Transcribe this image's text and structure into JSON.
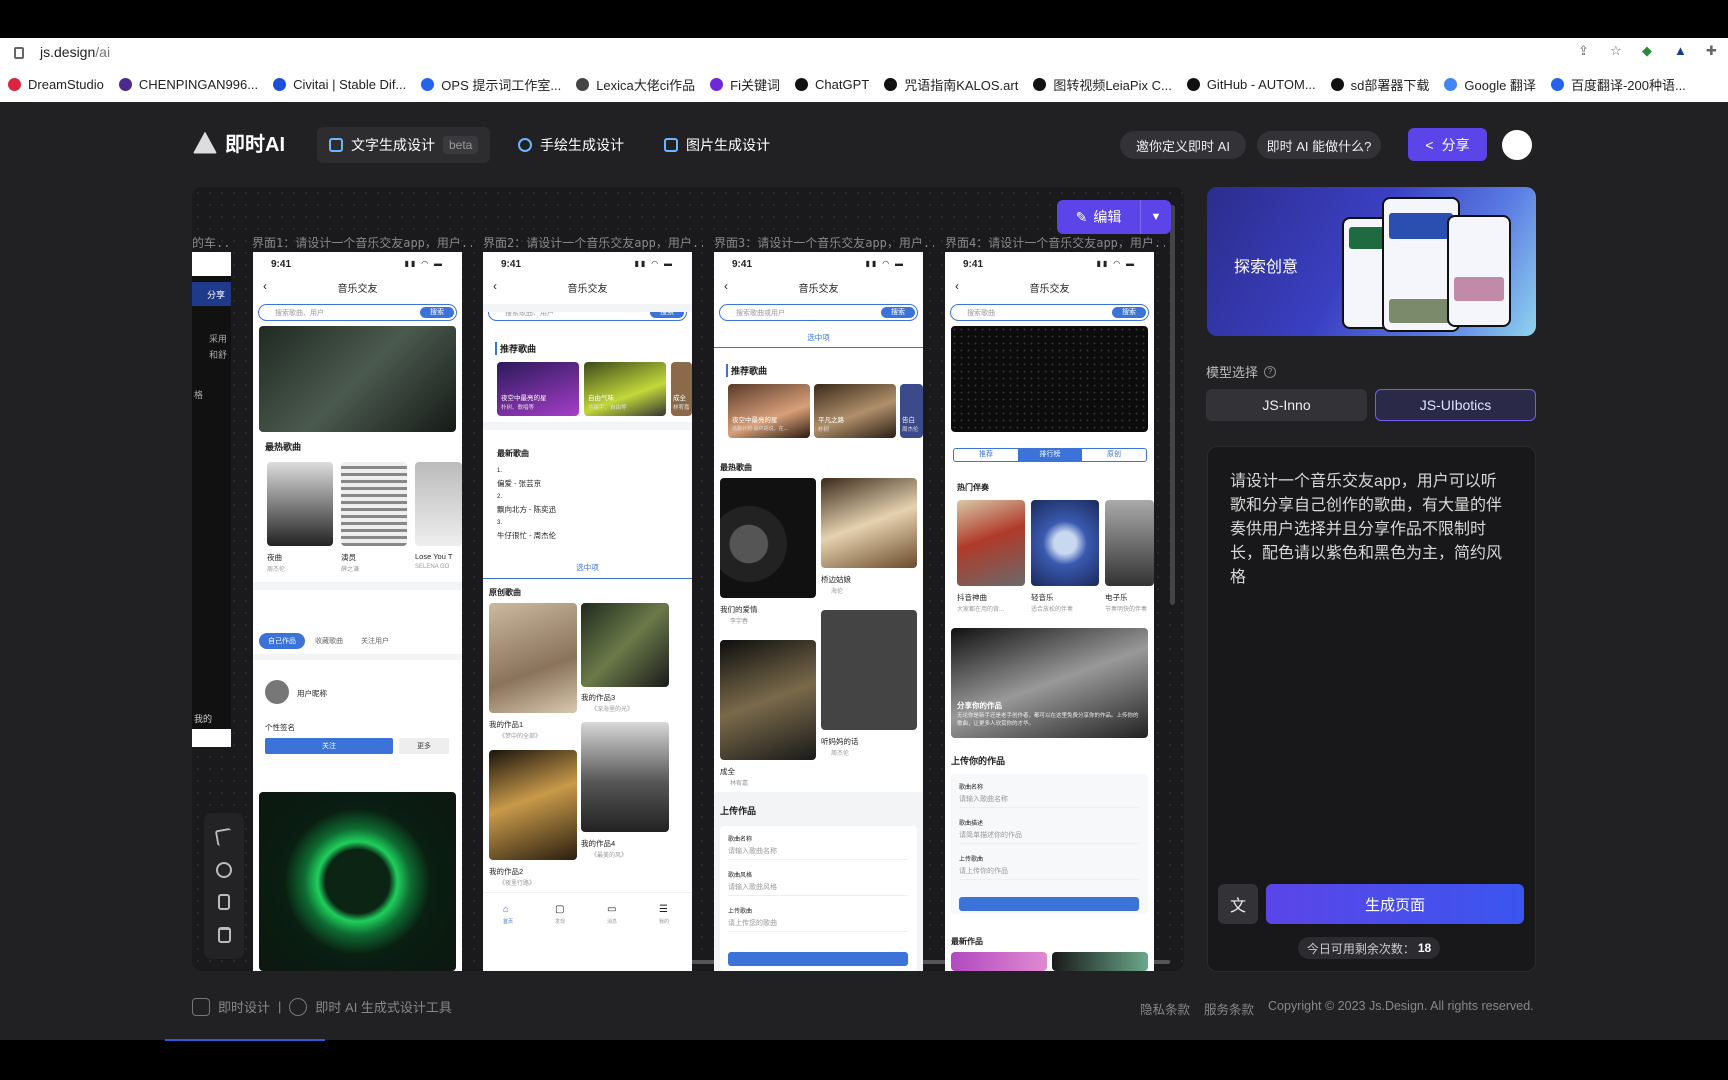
{
  "browser": {
    "url_host": "js.design",
    "url_path": "/ai",
    "bookmarks": [
      {
        "label": "DreamStudio",
        "color": "#d7263d"
      },
      {
        "label": "CHENPINGAN996...",
        "color": "#4a2a8a"
      },
      {
        "label": "Civitai | Stable Dif...",
        "color": "#1d4ed8"
      },
      {
        "label": "OPS 提示词工作室...",
        "color": "#2563eb"
      },
      {
        "label": "Lexica大佬ci作品",
        "color": "#444444"
      },
      {
        "label": "Fi关键词",
        "color": "#6d28d9"
      },
      {
        "label": "ChatGPT",
        "color": "#111111"
      },
      {
        "label": "咒语指南KALOS.art",
        "color": "#111111"
      },
      {
        "label": "图转视频LeiaPix C...",
        "color": "#111111"
      },
      {
        "label": "GitHub - AUTOM...",
        "color": "#111111"
      },
      {
        "label": "sd部署器下载",
        "color": "#111111"
      },
      {
        "label": "Google 翻译",
        "color": "#4285f4"
      },
      {
        "label": "百度翻译-200种语...",
        "color": "#2563eb"
      }
    ]
  },
  "header": {
    "logo": "即时AI",
    "tabs": [
      {
        "label": "文字生成设计",
        "badge": "beta"
      },
      {
        "label": "手绘生成设计"
      },
      {
        "label": "图片生成设计"
      }
    ],
    "invite": "邀你定义即时 AI",
    "what": "即时 AI 能做什么?",
    "share": "分享"
  },
  "canvas": {
    "edit_label": "编辑",
    "partial_label": "的车...",
    "partial_texts": [
      "分享",
      "采用",
      "和舒",
      "格",
      "我的"
    ],
    "screens": [
      {
        "label": "界面1：请设计一个音乐交友app，用户...",
        "time": "9:41",
        "title": "音乐交友",
        "search": "搜索歌曲、用户",
        "search_btn": "搜索",
        "section": "最热歌曲",
        "songs": [
          {
            "name": "夜曲",
            "artist": "周杰伦"
          },
          {
            "name": "演员",
            "artist": "薛之谦"
          },
          {
            "name": "Lose You T",
            "artist": "SELENA GO"
          }
        ],
        "tabs": [
          "自己作品",
          "收藏歌曲",
          "关注用户"
        ],
        "user": "用户昵称",
        "sig": "个性签名",
        "follow": "关注",
        "more": "更多"
      },
      {
        "label": "界面2：请设计一个音乐交友app，用户...",
        "time": "9:41",
        "title": "音乐交友",
        "search": "搜索歌曲、用户",
        "search_btn": "搜索",
        "section": "推荐歌曲",
        "rec": [
          {
            "name": "夜空中最亮的星",
            "sub": "朴树、歌唱等"
          },
          {
            "name": "自由气味",
            "sub": "华晨宇、自由等"
          },
          {
            "name": "成全",
            "sub": "林宥嘉"
          }
        ],
        "latest": "最新歌曲",
        "latest_items": [
          "偏爱 - 张芸京",
          "飘向北方 - 陈奕迅",
          "牛仔很忙 - 周杰伦"
        ],
        "nums": [
          "1.",
          "2.",
          "3."
        ],
        "selected": "选中项",
        "orig": "原创歌曲",
        "works": [
          {
            "name": "我的作品1",
            "sub": "《梦中的全部》"
          },
          {
            "name": "我的作品3",
            "sub": "《深海里的光》"
          },
          {
            "name": "我的作品2",
            "sub": "《夜里行路》"
          },
          {
            "name": "我的作品4",
            "sub": "《最美的风》"
          }
        ],
        "nav": [
          "首页",
          "发现",
          "消息",
          "我的"
        ]
      },
      {
        "label": "界面3：请设计一个音乐交友app，用户...",
        "time": "9:41",
        "title": "音乐交友",
        "search": "搜索歌曲或用户",
        "search_btn": "搜索",
        "selected": "选中项",
        "section": "推荐歌曲",
        "rec": [
          {
            "name": "夜空中最亮的星",
            "sub": "逃跑计划·最终胡说，在..."
          },
          {
            "name": "平凡之路",
            "sub": "朴树"
          },
          {
            "name": "告白",
            "sub": "周杰伦"
          }
        ],
        "hot": "最热歌曲",
        "songs": [
          {
            "name": "我们的爱情",
            "artist": "李宇春"
          },
          {
            "name": "桥边姑娘",
            "artist": "海伦"
          },
          {
            "name": "成全",
            "artist": "林宥嘉"
          },
          {
            "name": "听妈妈的话",
            "artist": "周杰伦"
          }
        ],
        "upload": "上传作品",
        "f1": "歌曲名称",
        "p1": "请输入歌曲名称",
        "f2": "歌曲风格",
        "p2": "请输入歌曲风格",
        "f3": "上传歌曲",
        "p3": "请上传您的歌曲"
      },
      {
        "label": "界面4：请设计一个音乐交友app，用户...",
        "time": "9:41",
        "title": "音乐交友",
        "search": "搜索歌曲",
        "search_btn": "搜索",
        "tabs": [
          "推荐",
          "排行榜",
          "原创"
        ],
        "hot": "热门伴奏",
        "acc": [
          {
            "name": "抖音神曲",
            "sub": "大家都在用的背..."
          },
          {
            "name": "轻音乐",
            "sub": "适合放松的伴奏"
          },
          {
            "name": "电子乐",
            "sub": "节奏明快的伴奏"
          }
        ],
        "share_title": "分享你的作品",
        "share_sub": "无论你是新手还是老手创作者，都可以在这里免费分享你的作品。上传你的歌曲，让更多人欣赏你的才华。",
        "upload": "上传你的作品",
        "f1": "歌曲名称",
        "p1": "请输入歌曲名称",
        "f2": "歌曲描述",
        "p2": "请简单描述你的作品",
        "f3": "上传歌曲",
        "p3": "请上传你的作品",
        "latest": "最新作品"
      }
    ]
  },
  "panel": {
    "explore": "探索创意",
    "model_label": "模型选择",
    "models": [
      "JS-Inno",
      "JS-UIbotics"
    ],
    "prompt": "请设计一个音乐交友app，用户可以听歌和分享自己创作的歌曲，有大量的伴奏供用户选择并且分享作品不限制时长，配色请以紫色和黑色为主，简约风格",
    "generate": "生成页面",
    "remain_label": "今日可用剩余次数：",
    "remain_count": "18"
  },
  "footer": {
    "brand": "即时设计",
    "tool": "即时 AI 生成式设计工具",
    "privacy": "隐私条款",
    "terms": "服务条款",
    "copyright": "Copyright © 2023 Js.Design. All rights reserved."
  },
  "colors": {
    "accent": "#5b45e8",
    "ui_blue": "#3b73d9",
    "app_bg": "#212123"
  },
  "icons": [
    "lock-icon",
    "share-page-icon",
    "star-icon",
    "extension-icon",
    "edit-icon",
    "chevron-down-icon",
    "pointer-icon",
    "target-icon",
    "mobile-icon",
    "trash-icon",
    "translate-icon",
    "help-icon"
  ]
}
